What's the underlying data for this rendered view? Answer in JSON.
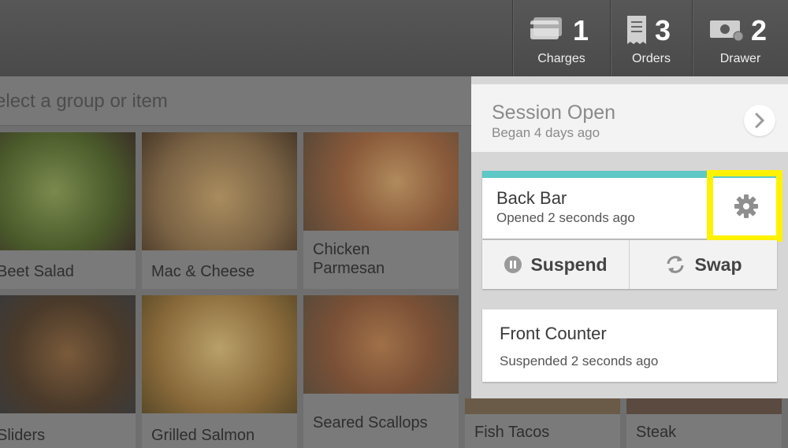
{
  "header": {
    "stats": [
      {
        "count": "1",
        "label": "Charges",
        "icon": "credit-card-icon"
      },
      {
        "count": "3",
        "label": "Orders",
        "icon": "receipt-icon"
      },
      {
        "count": "2",
        "label": "Drawer",
        "icon": "cash-icon"
      }
    ]
  },
  "search": {
    "placeholder": "Select a group or item"
  },
  "menu": {
    "items": [
      {
        "name": "Beet Salad"
      },
      {
        "name": "Mac & Cheese"
      },
      {
        "name": "Chicken\nParmesan"
      },
      {
        "name": "Sliders"
      },
      {
        "name": "Grilled Salmon"
      },
      {
        "name": "Seared Scallops"
      },
      {
        "name": "Fish Tacos"
      },
      {
        "name": "Steak"
      }
    ]
  },
  "session": {
    "title": "Session Open",
    "subtitle": "Began 4 days ago",
    "active_register": {
      "name": "Back Bar",
      "status": "Opened 2 seconds ago"
    },
    "actions": {
      "suspend": "Suspend",
      "swap": "Swap"
    },
    "suspended_register": {
      "name": "Front Counter",
      "status": "Suspended 2 seconds ago"
    }
  },
  "colors": {
    "accent": "#5ec8c6",
    "highlight": "#fff200"
  }
}
